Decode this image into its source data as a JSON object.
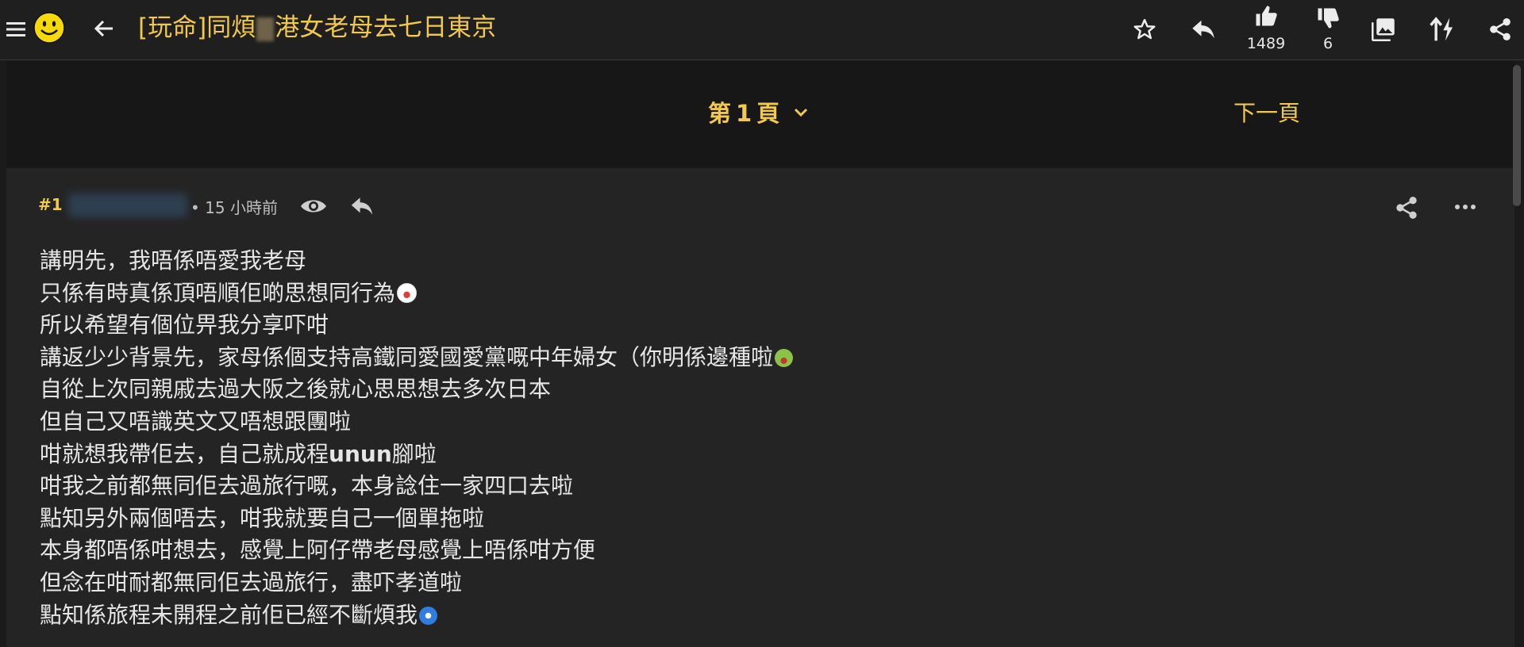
{
  "header": {
    "title_prefix": "[玩命]同煩",
    "title_suffix": "港女老母去七日東京",
    "like_count": "1489",
    "dislike_count": "6",
    "icons": [
      "menu-icon",
      "smiley-logo-icon",
      "back-arrow-icon",
      "star-icon",
      "reply-icon",
      "thumbs-up-icon",
      "thumbs-down-icon",
      "images-icon",
      "sort-icon",
      "share-icon"
    ]
  },
  "pager": {
    "page_prefix": "第",
    "page_number": "1",
    "page_suffix": "頁",
    "next_label": "下一頁"
  },
  "post": {
    "number": "#1",
    "time_separator": "•",
    "time": "15 小時前",
    "lines": [
      "講明先，我唔係唔愛我老母",
      "只係有時真係頂唔順佢啲思想同行為",
      "所以希望有個位畀我分享吓咁",
      "講返少少背景先，家母係個支持高鐵同愛國愛黨嘅中年婦女（你明係邊種啦",
      "自從上次同親戚去過大阪之後就心思思想去多次日本",
      "但自己又唔識英文又唔想跟團啦",
      "咁就想我帶佢去，自己就成程",
      "咁我之前都無同佢去過旅行嘅，本身諗住一家四口去啦",
      "點知另外兩個唔去，咁我就要自己一個單拖啦",
      "本身都唔係咁想去，感覺上阿仔帶老母感覺上唔係咁方便",
      "但念在咁耐都無同佢去過旅行，盡吓孝道啦",
      "點知係旅程未開程之前佢已經不斷煩我"
    ],
    "line7_bold": "unun",
    "line7_tail": "腳啦"
  },
  "colors": {
    "accent": "#f2c94c",
    "background": "#1b1b1b",
    "post_bg": "#242424",
    "text": "#e6e6e6"
  }
}
